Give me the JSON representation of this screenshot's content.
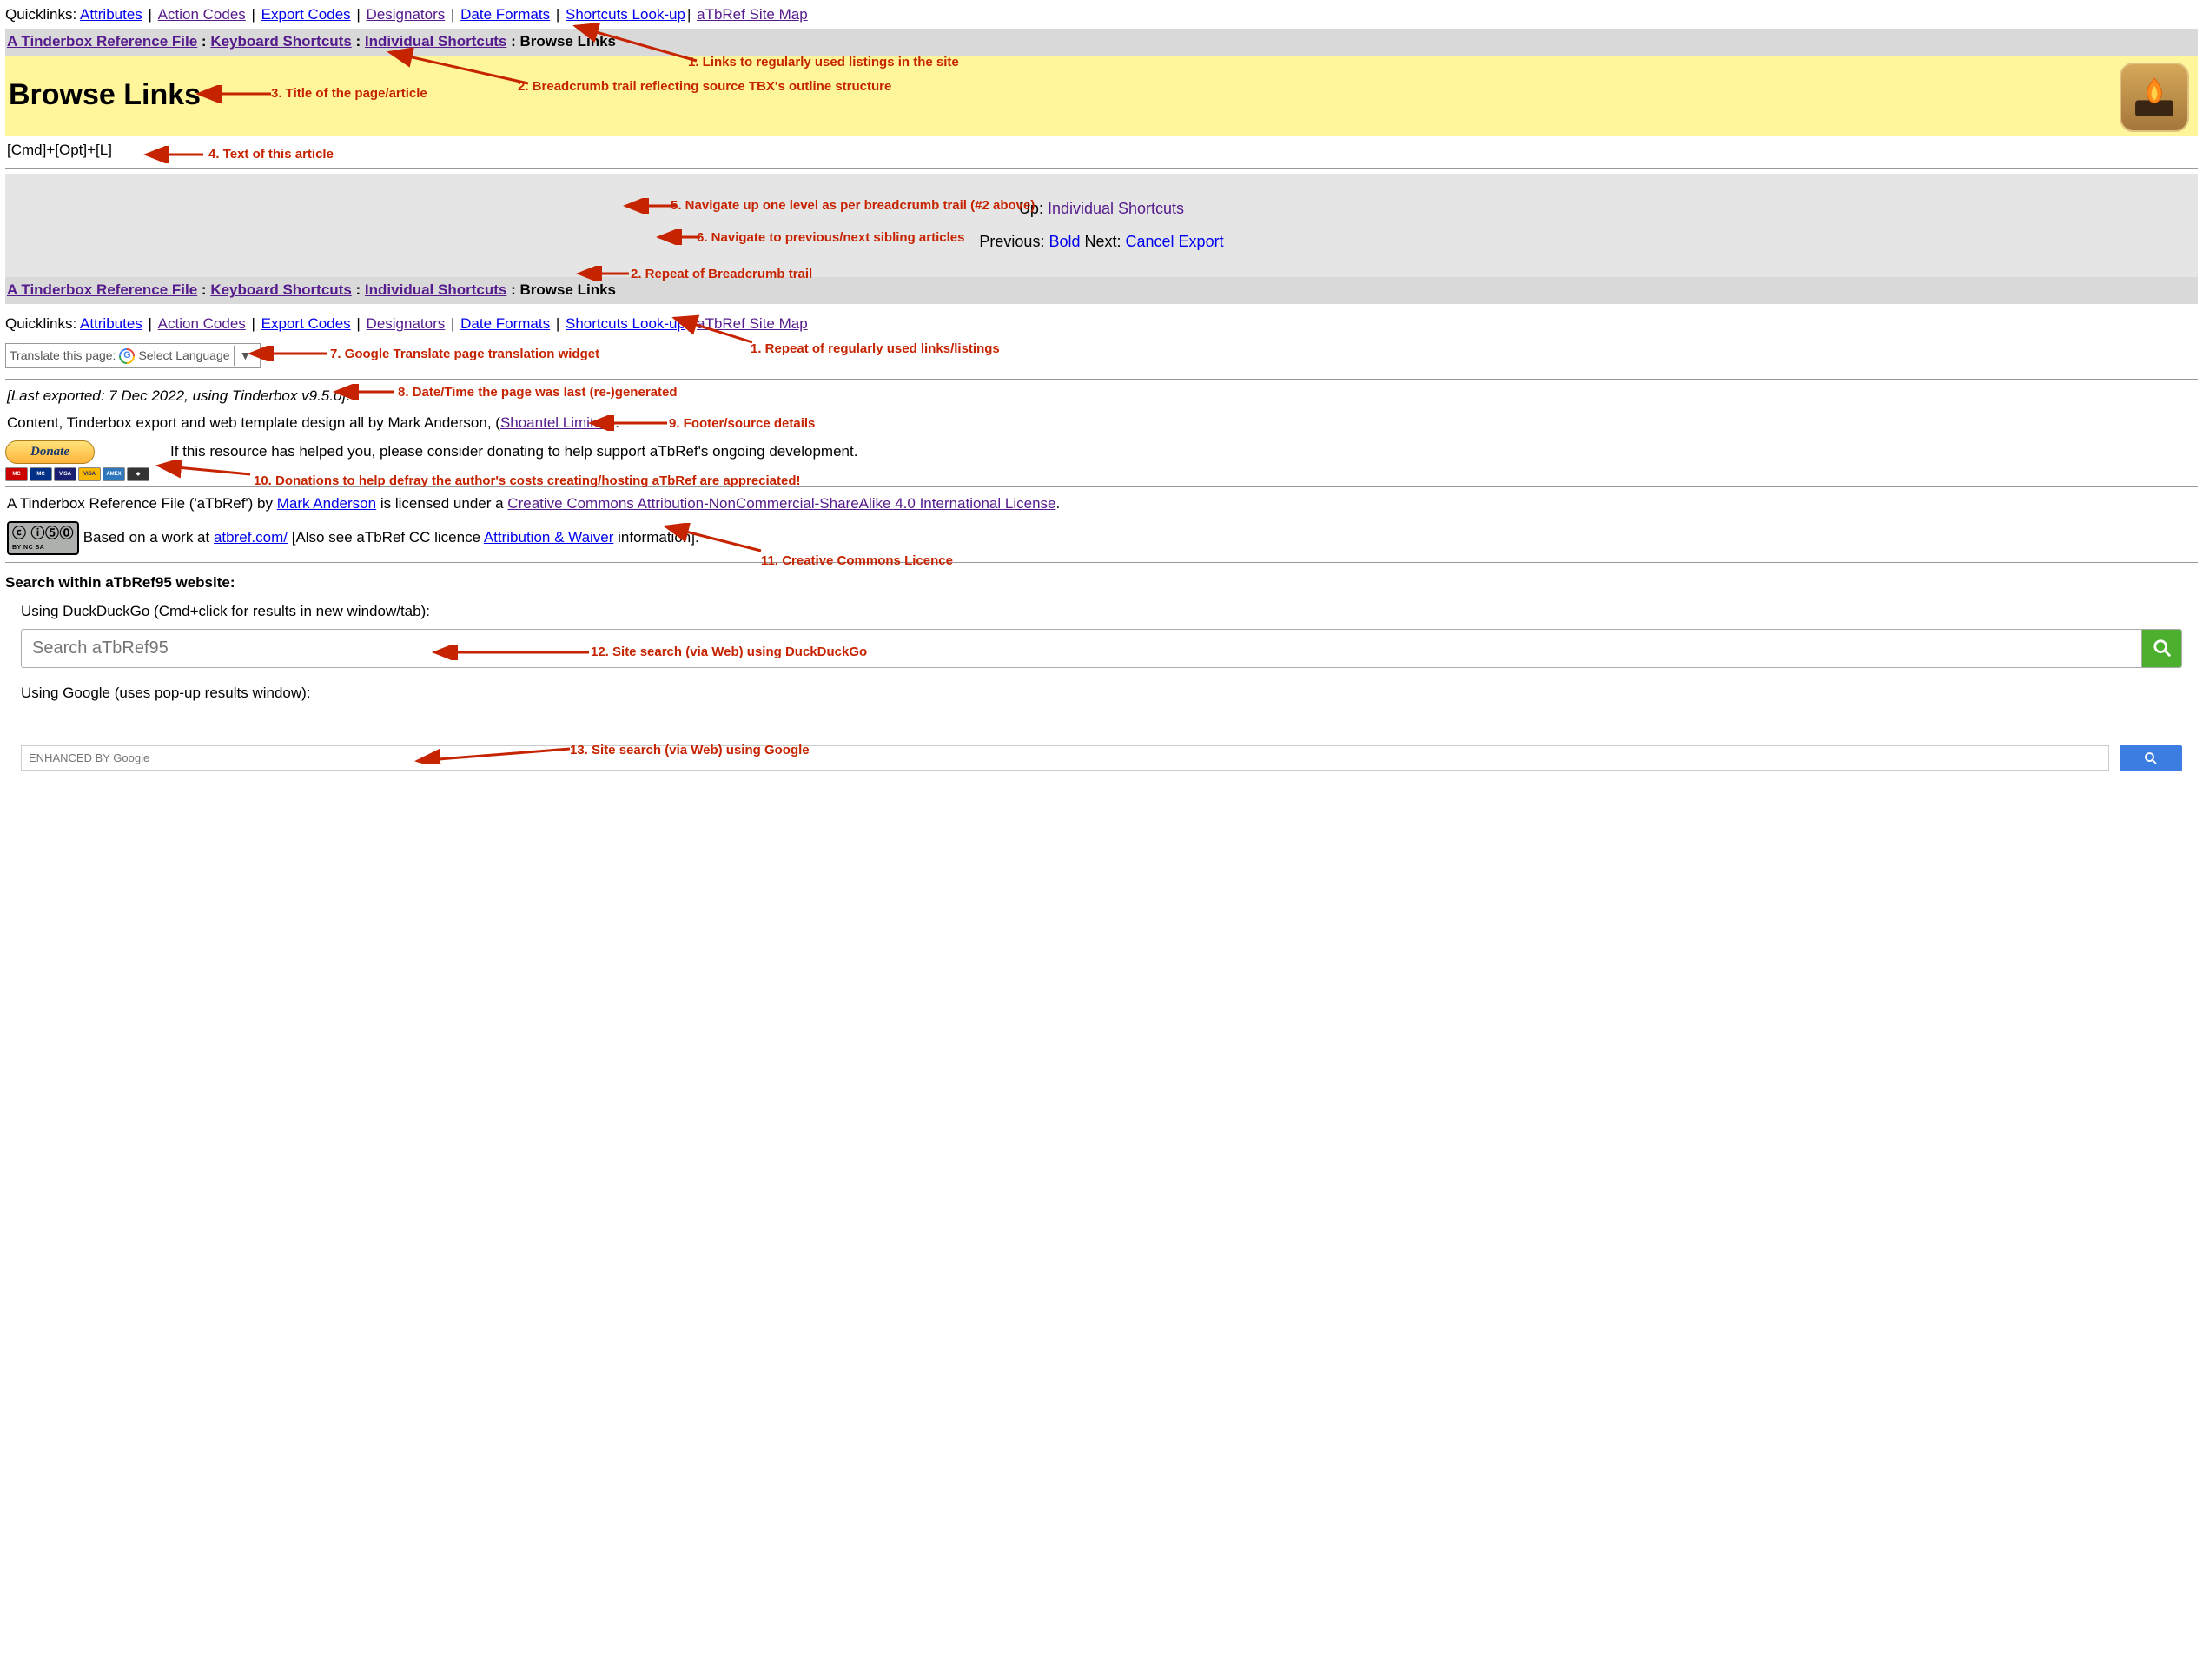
{
  "quicklinks": {
    "label": "Quicklinks: ",
    "items": [
      {
        "label": "Attributes",
        "visited": false
      },
      {
        "label": "Action Codes",
        "visited": true
      },
      {
        "label": "Export Codes",
        "visited": false
      },
      {
        "label": "Designators",
        "visited": true
      },
      {
        "label": "Date Formats",
        "visited": false
      },
      {
        "label": "Shortcuts Look-up",
        "visited": false
      },
      {
        "label": "aTbRef Site Map",
        "visited": true
      }
    ]
  },
  "breadcrumb": {
    "items": [
      {
        "label": "A Tinderbox Reference File",
        "visited": true
      },
      {
        "label": "Keyboard Shortcuts",
        "visited": true
      },
      {
        "label": "Individual Shortcuts",
        "visited": true
      }
    ],
    "current": "Browse Links"
  },
  "page": {
    "title": "Browse Links",
    "body": "[Cmd]+[Opt]+[L]"
  },
  "nav": {
    "up_label": "Up: ",
    "up_link": "Individual Shortcuts",
    "prev_label": "Previous: ",
    "prev_link": "Bold",
    "next_label": "  Next: ",
    "next_link": "Cancel Export"
  },
  "translate": {
    "prefix": "Translate this page:",
    "select": "Select Language",
    "caret": "▼"
  },
  "export_meta": "[Last exported: 7 Dec 2022, using Tinderbox v9.5.0]",
  "credits": {
    "prefix": "Content, Tinderbox export and web template design all by Mark Anderson, (",
    "link": "Shoantel Limited",
    "suffix": ")."
  },
  "donate": {
    "button": "Donate",
    "text": "If this resource has helped you, please consider donating to help support aTbRef's ongoing development."
  },
  "license": {
    "line1_a": "A Tinderbox Reference File ('aTbRef') by ",
    "line1_link1": "Mark Anderson",
    "line1_b": " is licensed under a ",
    "line1_link2": "Creative Commons Attribution-NonCommercial-ShareAlike 4.0 International License",
    "line1_c": ".",
    "badge_top": "ⓒ ⓘ⑤⓪",
    "badge_bottom": "BY   NC   SA",
    "line2_a": " Based on a work at ",
    "line2_link": "atbref.com/",
    "line2_b": " [Also see aTbRef CC licence ",
    "line2_link2": "Attribution & Waiver",
    "line2_c": " information]."
  },
  "search": {
    "heading": "Search within aTbRef95 website:",
    "ddg_label": "Using DuckDuckGo (Cmd+click for results in new window/tab):",
    "ddg_placeholder": "Search aTbRef95",
    "google_label": "Using Google (uses pop-up results window):",
    "google_placeholder": "ENHANCED BY Google"
  },
  "annotations": {
    "a1": "1. Links to regularly used listings in the site",
    "a2": "2. Breadcrumb trail reflecting source TBX's outline structure",
    "a3": "3. Title of the page/article",
    "a4": "4. Text of this article",
    "a5": "5. Navigate up one level as per breadcrumb trail (#2 above)",
    "a6": "6. Navigate to previous/next sibling articles",
    "a2r": "2. Repeat of Breadcrumb trail",
    "a1r": "1. Repeat of regularly used links/listings",
    "a7": "7. Google Translate page translation widget",
    "a8": "8. Date/Time the page was last (re-)generated",
    "a9": "9. Footer/source details",
    "a10": "10. Donations to help defray the author's costs creating/hosting aTbRef are appreciated!",
    "a11": "11. Creative Commons Licence",
    "a12": "12. Site search (via Web) using DuckDuckGo",
    "a13": "13. Site search (via Web) using Google"
  }
}
